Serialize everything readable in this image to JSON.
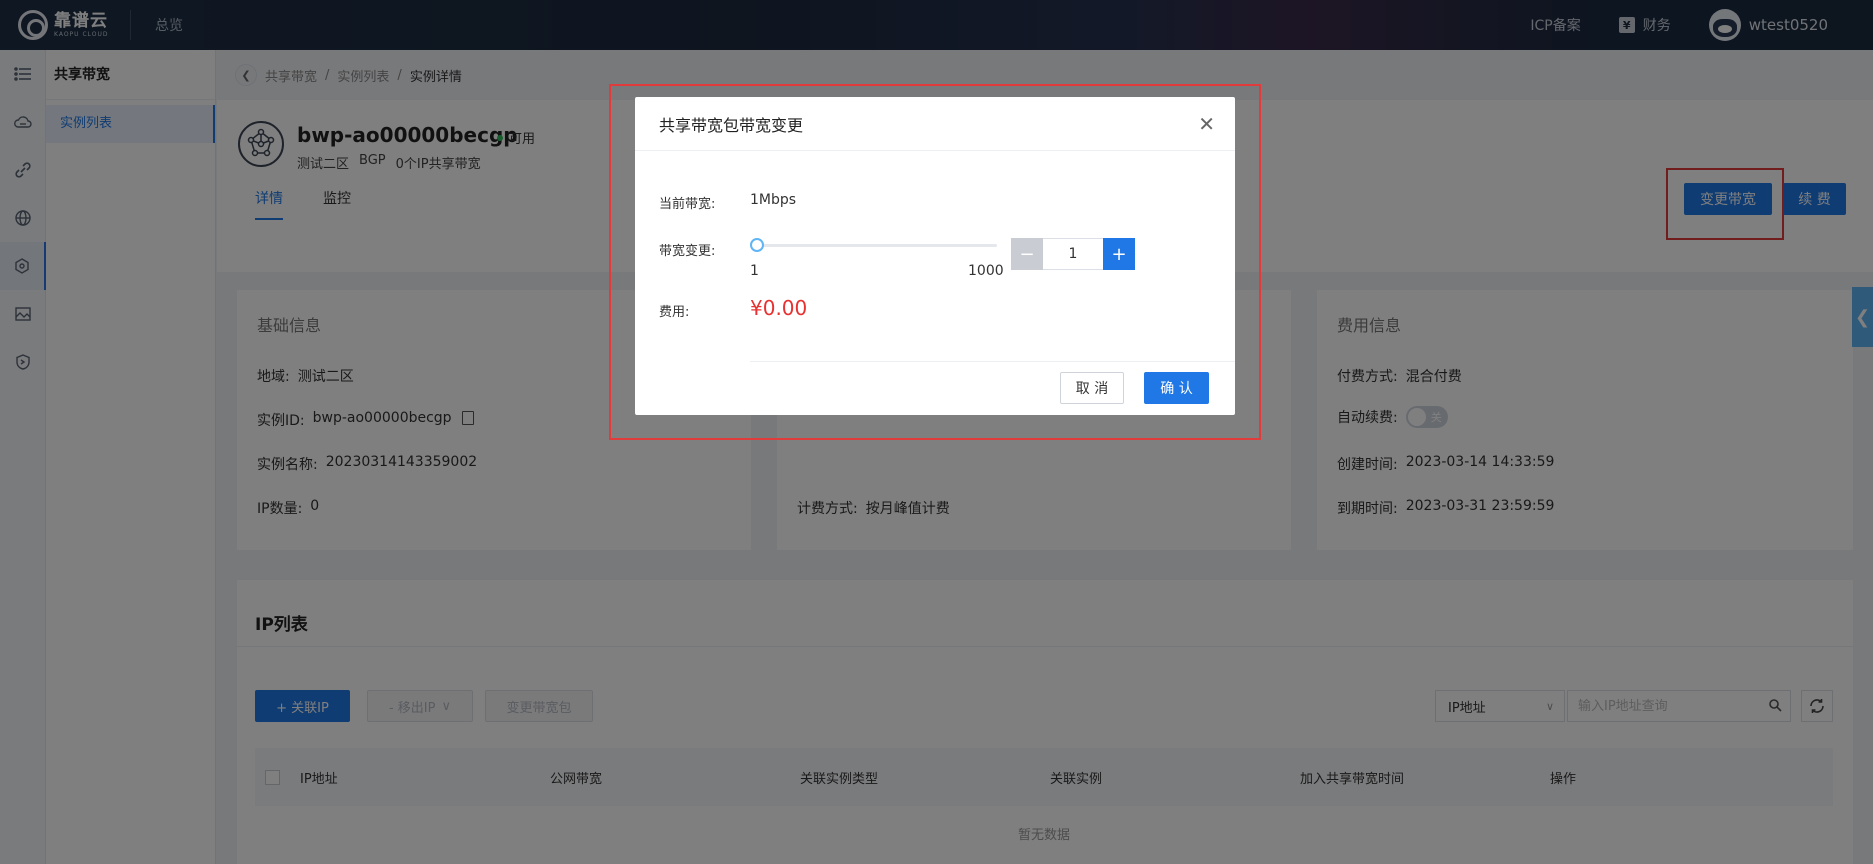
{
  "topbar": {
    "logo_cn": "靠谱云",
    "logo_en": "KAOPU CLOUD",
    "overview": "总览",
    "icp": "ICP备案",
    "finance": "财务",
    "finance_icon": "yen-icon",
    "username": "wtest0520"
  },
  "rail": {
    "icons": [
      "menu-icon",
      "cloud-icon",
      "link-icon",
      "globe-icon",
      "network-share-icon",
      "image-icon",
      "shield-icon"
    ],
    "active_index": 4
  },
  "subnav": {
    "title": "共享带宽",
    "items": [
      {
        "label": "实例列表"
      }
    ]
  },
  "breadcrumb": {
    "back_icon": "chevron-left-icon",
    "items": [
      "共享带宽",
      "实例列表",
      "实例详情"
    ],
    "separator": "/"
  },
  "instance": {
    "name": "bwp-ao00000becgp",
    "status": "可用",
    "status_color": "#2ebf5f",
    "region": "测试二区",
    "line": "BGP",
    "ip_share": "0个IP共享带宽",
    "tabs": [
      {
        "label": "详情"
      },
      {
        "label": "监控"
      }
    ],
    "active_tab": 0,
    "actions": {
      "change_bandwidth": "变更带宽",
      "renew": "续 费"
    }
  },
  "basic_info": {
    "title": "基础信息",
    "rows": [
      {
        "k": "地域:",
        "v": "测试二区"
      },
      {
        "k": "实例ID:",
        "v": "bwp-ao00000becgp"
      },
      {
        "k": "实例名称:",
        "v": "20230314143359002"
      },
      {
        "k": "IP数量:",
        "v": "0"
      }
    ]
  },
  "billing_mid": {
    "billing_method_k": "计费方式:",
    "billing_method_v": "按月峰值计费"
  },
  "fee_info": {
    "title": "费用信息",
    "rows": [
      {
        "k": "付费方式:",
        "v": "混合付费"
      },
      {
        "k": "自动续费:",
        "v": "关"
      },
      {
        "k": "创建时间:",
        "v": "2023-03-14 14:33:59"
      },
      {
        "k": "到期时间:",
        "v": "2023-03-31 23:59:59"
      }
    ]
  },
  "ip_list": {
    "title": "IP列表",
    "add_button": "+ 关联IP",
    "remove_button": "- 移出IP",
    "change_bw_button": "变更带宽包",
    "filter_select": "IP地址",
    "search_placeholder": "输入IP地址查询",
    "columns": [
      "IP地址",
      "公网带宽",
      "关联实例类型",
      "关联实例",
      "加入共享带宽时间",
      "操作"
    ],
    "empty_text": "暂无数据"
  },
  "dialog": {
    "title": "共享带宽包带宽变更",
    "current_label": "当前带宽:",
    "current_value": "1Mbps",
    "change_label": "带宽变更:",
    "slider_min": "1",
    "slider_max": "1000",
    "slider_value": 1,
    "stepper_value": "1",
    "fee_label": "费用:",
    "fee_value": "¥0.00",
    "cancel": "取 消",
    "confirm": "确 认"
  },
  "colors": {
    "primary": "#1f78e6",
    "price": "#e83131",
    "highlight": "#e23b3b"
  }
}
